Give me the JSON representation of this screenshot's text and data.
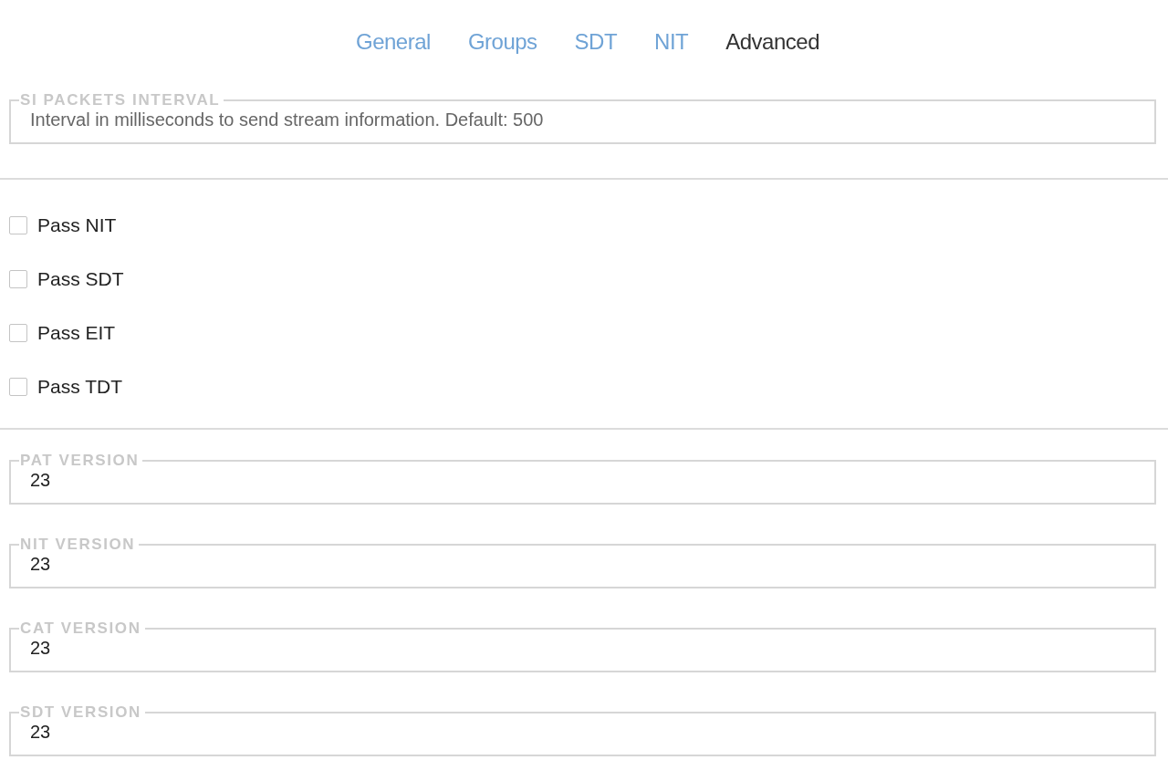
{
  "tabs": [
    {
      "label": "General",
      "selected": false
    },
    {
      "label": "Groups",
      "selected": false
    },
    {
      "label": "SDT",
      "selected": false
    },
    {
      "label": "NIT",
      "selected": false
    },
    {
      "label": "Advanced",
      "selected": true
    }
  ],
  "si_packets_interval": {
    "label": "SI PACKETS INTERVAL",
    "placeholder": "Interval in milliseconds to send stream information. Default: 500"
  },
  "checkboxes": [
    {
      "label": "Pass NIT",
      "checked": false
    },
    {
      "label": "Pass SDT",
      "checked": false
    },
    {
      "label": "Pass EIT",
      "checked": false
    },
    {
      "label": "Pass TDT",
      "checked": false
    }
  ],
  "version_fields": [
    {
      "label": "PAT VERSION",
      "value": "23"
    },
    {
      "label": "NIT VERSION",
      "value": "23"
    },
    {
      "label": "CAT VERSION",
      "value": "23"
    },
    {
      "label": "SDT VERSION",
      "value": "23"
    }
  ]
}
